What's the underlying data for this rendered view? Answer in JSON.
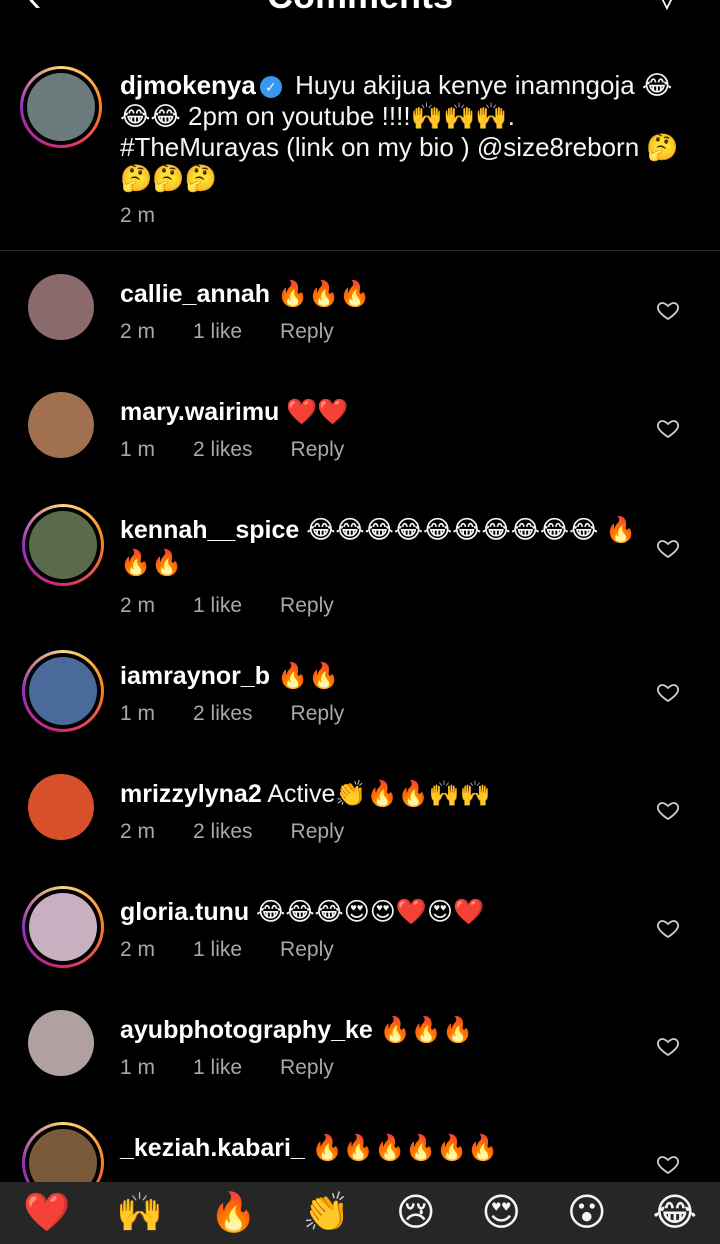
{
  "header": {
    "back_icon": "‹",
    "title": "Comments",
    "send_icon": "▽"
  },
  "caption": {
    "username": "djmokenya",
    "verified": "✓",
    "text": "Huyu akijua kenye inamngoja 😂😂😂 2pm on youtube !!!!🙌🙌🙌. #TheMurayas (link on my bio ) @size8reborn 🤔🤔🤔🤔",
    "time": "2 m",
    "avatar_color": "#6b7a7a"
  },
  "comments": [
    {
      "username": "callie_annah",
      "text": "🔥🔥🔥",
      "time": "2 m",
      "likes": "1 like",
      "reply": "Reply",
      "avatar_color": "#8a6a6a",
      "ring": false
    },
    {
      "username": "mary.wairimu",
      "text": "❤️❤️",
      "time": "1 m",
      "likes": "2 likes",
      "reply": "Reply",
      "avatar_color": "#a07050",
      "ring": false
    },
    {
      "username": "kennah__spice",
      "text": "😂😂😂😂😂😂😂😂😂😂 🔥🔥🔥",
      "time": "2 m",
      "likes": "1 like",
      "reply": "Reply",
      "avatar_color": "#5a6a4a",
      "ring": true
    },
    {
      "username": "iamraynor_b",
      "text": "🔥🔥",
      "time": "1 m",
      "likes": "2 likes",
      "reply": "Reply",
      "avatar_color": "#4a6a9a",
      "ring": true
    },
    {
      "username": "mrizzylyna2",
      "text": "Active👏🔥🔥🙌🙌",
      "time": "2 m",
      "likes": "2 likes",
      "reply": "Reply",
      "avatar_color": "#d8502a",
      "ring": false
    },
    {
      "username": "gloria.tunu",
      "text": "😂😂😂😍😍❤️😍❤️",
      "time": "2 m",
      "likes": "1 like",
      "reply": "Reply",
      "avatar_color": "#c8b0c0",
      "ring": true
    },
    {
      "username": "ayubphotography_ke",
      "text": "🔥🔥🔥",
      "time": "1 m",
      "likes": "1 like",
      "reply": "Reply",
      "avatar_color": "#b0a0a0",
      "ring": false
    },
    {
      "username": "_keziah.kabari_",
      "text": "🔥🔥🔥🔥🔥🔥",
      "time": "",
      "likes": "",
      "reply": "",
      "avatar_color": "#7a5a3a",
      "ring": true
    }
  ],
  "emoji_bar": [
    "❤️",
    "🙌",
    "🔥",
    "👏",
    "😢",
    "😍",
    "😮",
    "😂"
  ]
}
